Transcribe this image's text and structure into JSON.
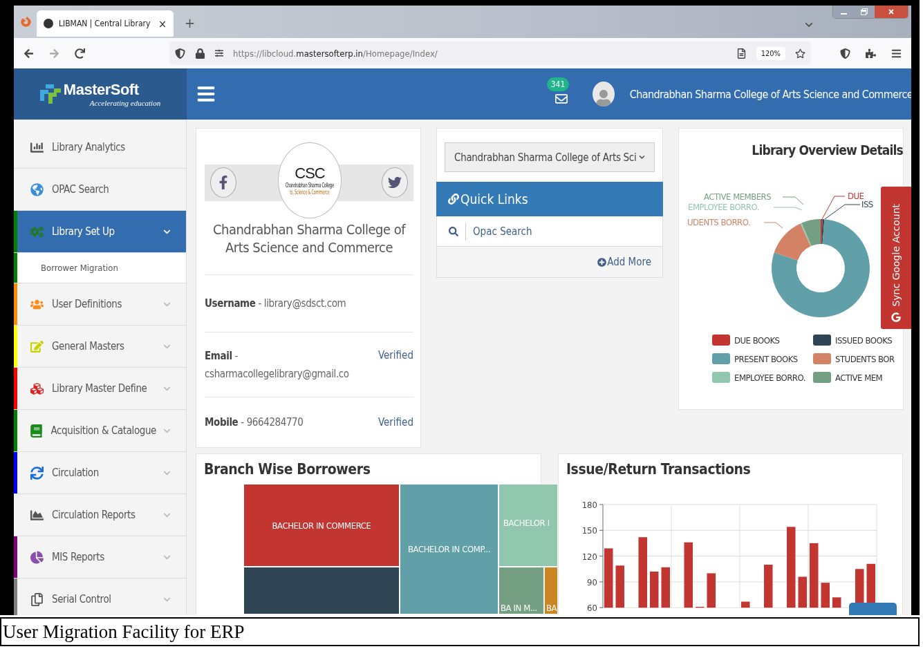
{
  "browser": {
    "tab_title": "LIBMAN | Central Library",
    "tab_close": "×",
    "new_tab": "+",
    "url": {
      "host": "https://libcloud.",
      "domain": "mastersofterp.in",
      "path": "/Homepage/Index/"
    },
    "zoom": "120%"
  },
  "header": {
    "logo_name": "MasterSoft",
    "logo_tagline": "Accelerating education",
    "mail_count": "341",
    "user_name": "Chandrabhan Sharma College of Arts Science and Commerce"
  },
  "sidebar": {
    "items": [
      {
        "label": "Library Analytics",
        "selected": false
      },
      {
        "label": "OPAC Search",
        "selected": false
      },
      {
        "label": "Library Set Up",
        "selected": true,
        "color": "#008000",
        "children": [
          {
            "label": "Borrower Migration",
            "color": "#008000"
          }
        ]
      },
      {
        "label": "User Definitions",
        "selected": false,
        "color": "#ff8c00"
      },
      {
        "label": "General Masters",
        "selected": false,
        "color": "#ffff00"
      },
      {
        "label": "Library Master Define",
        "selected": false,
        "color": "#ff0000"
      },
      {
        "label": "Acquisition & Catalogue",
        "selected": false,
        "color": "#008000"
      },
      {
        "label": "Circulation",
        "selected": false,
        "color": "#0000ff"
      },
      {
        "label": "Circulation Reports",
        "selected": false
      },
      {
        "label": "MIS Reports",
        "selected": false,
        "color": "#800080"
      },
      {
        "label": "Serial Control",
        "selected": false,
        "color": "#808080"
      }
    ]
  },
  "profile": {
    "logo_text": "CSC",
    "logo_caption": "Chandrabhan Sharma College",
    "logo_subcaption": "ts, Science & Commerce",
    "college_name": "Chandrabhan Sharma College of Arts Science and Commerce",
    "fields": [
      {
        "label": "Username",
        "separator": "-",
        "value": "library@sdsct.com"
      },
      {
        "label": "Email",
        "separator": "-",
        "value": "csharmacollegelibrary@gmail.co",
        "status": "Verified"
      },
      {
        "label": "Mobile",
        "separator": "-",
        "value": "9664284770",
        "status": "Verified"
      }
    ]
  },
  "quick_links": {
    "college_select": "Chandrabhan Sharma College of Arts Sci",
    "title": "Quick Links",
    "links": [
      "Opac Search"
    ],
    "add_more": "Add More"
  },
  "overview": {
    "title": "Library Overview Details",
    "slice_labels": [
      {
        "text": "ACTIVE MEMBERS",
        "color": "#749f83"
      },
      {
        "text": "EMPLOYEE BORRO.",
        "color": "#91c7ae"
      },
      {
        "text": "UDENTS BORRO.",
        "color": "#d48265"
      },
      {
        "text": "DUE",
        "color": "#c23531"
      },
      {
        "text": "ISS",
        "color": "#2f4554"
      }
    ],
    "legend": [
      {
        "label": "DUE BOOKS",
        "color": "#c23531"
      },
      {
        "label": "ISSUED BOOKS",
        "color": "#2f4554"
      },
      {
        "label": "PRESENT BOOKS",
        "color": "#61a0a8"
      },
      {
        "label": "STUDENTS BOR",
        "color": "#d48265"
      },
      {
        "label": "EMPLOYEE BORRO.",
        "color": "#91c7ae"
      },
      {
        "label": "ACTIVE MEM",
        "color": "#749f83"
      }
    ],
    "sync_button": "Sync Google Account"
  },
  "branch": {
    "title": "Branch Wise Borrowers",
    "tiles": [
      {
        "label": "BACHELOR IN COMMERCE",
        "color": "#c23531"
      },
      {
        "color": "#2f4554"
      },
      {
        "label": "BACHELOR IN COMP...",
        "color": "#61a0a8"
      },
      {
        "label": "BACHELOR I",
        "color": "#91c7ae"
      },
      {
        "label": "BA IN M...",
        "color": "#749f83"
      },
      {
        "label": "BA",
        "color": "#ca8622"
      }
    ]
  },
  "transactions": {
    "title": "Issue/Return Transactions",
    "chart_data": {
      "type": "bar",
      "grid": true,
      "ylim": [
        60,
        180
      ],
      "yticks": [
        60,
        90,
        120,
        150,
        180
      ],
      "series": [
        {
          "color": "#c23531",
          "values": [
            129,
            109,
            null,
            142,
            102,
            107,
            null,
            136,
            61,
            100,
            null,
            null,
            67,
            null,
            110,
            null,
            154,
            96,
            135,
            89,
            72,
            null,
            105,
            111
          ]
        }
      ]
    }
  },
  "caption": "User Migration Facility for ERP"
}
